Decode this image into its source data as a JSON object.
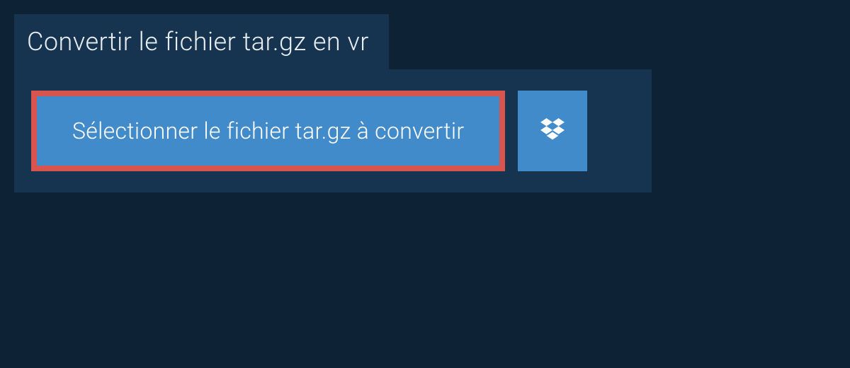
{
  "header": {
    "title": "Convertir le fichier tar.gz en vr"
  },
  "actions": {
    "select_file_label": "Sélectionner le fichier tar.gz à convertir",
    "dropbox_icon": "dropbox"
  }
}
